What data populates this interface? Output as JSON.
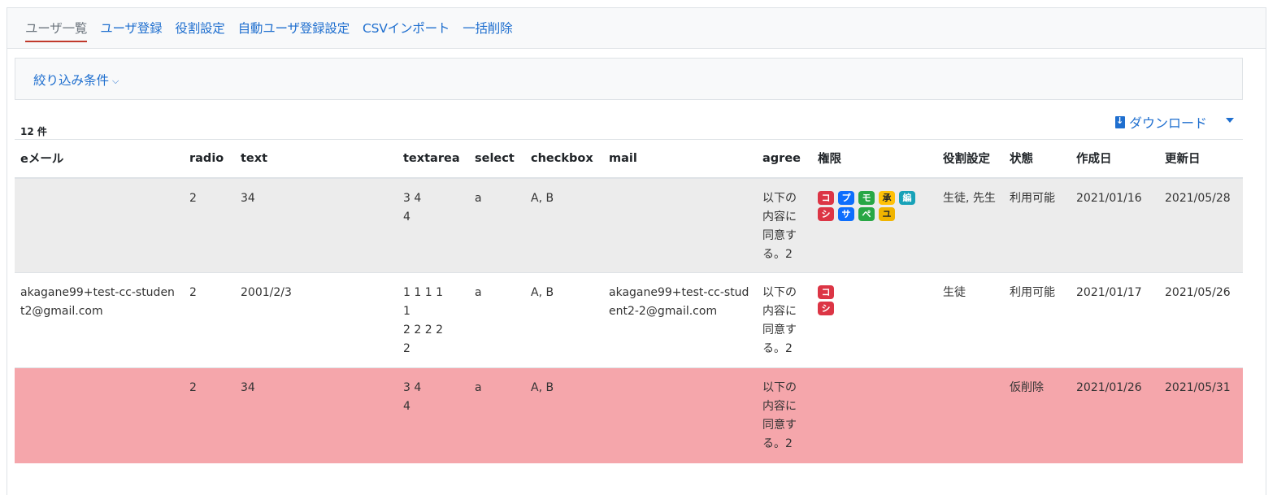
{
  "tabs": [
    {
      "label": "ユーザ一覧",
      "active": true
    },
    {
      "label": "ユーザ登録"
    },
    {
      "label": "役割設定"
    },
    {
      "label": "自動ユーザ登録設定"
    },
    {
      "label": "CSVインポート"
    },
    {
      "label": "一括削除"
    }
  ],
  "filter": {
    "label": "絞り込み条件"
  },
  "count_label": "12 件",
  "download": {
    "label": "ダウンロード"
  },
  "table": {
    "headers": [
      "eメール",
      "radio",
      "text",
      "textarea",
      "select",
      "checkbox",
      "mail",
      "agree",
      "権限",
      "役割設定",
      "状態",
      "作成日",
      "更新日"
    ],
    "rows": [
      {
        "email": "",
        "radio": "2",
        "text": "34",
        "textarea_lines": [
          "3 4",
          "4"
        ],
        "select": "a",
        "checkbox": "A, B",
        "mail": "",
        "agree": "以下の内容に同意する。2",
        "perm_badges": [
          "コ",
          "プ",
          "モ",
          "承",
          "編",
          "シ",
          "サ",
          "ペ",
          "ユ"
        ],
        "roles": "生徒, 先生",
        "status": "利用可能",
        "created": "2021/01/16",
        "updated": "2021/05/28"
      },
      {
        "email": "akagane99+test-cc-student2@gmail.com",
        "radio": "2",
        "text": "2001/2/3",
        "textarea_lines": [
          "1 1 1 1",
          "1",
          "2 2 2 2",
          "2"
        ],
        "select": "a",
        "checkbox": "A, B",
        "mail": "akagane99+test-cc-student2-2@gmail.com",
        "agree": "以下の内容に同意する。2",
        "perm_badges": [
          "コ",
          "シ"
        ],
        "roles": "生徒",
        "status": "利用可能",
        "created": "2021/01/17",
        "updated": "2021/05/26"
      },
      {
        "email": "",
        "radio": "2",
        "text": "34",
        "textarea_lines": [
          "3 4",
          "4"
        ],
        "select": "a",
        "checkbox": "A, B",
        "mail": "",
        "agree": "以下の内容に同意する。2",
        "perm_badges": [],
        "roles": "",
        "status": "仮削除",
        "created": "2021/01/26",
        "updated": "2021/05/31"
      }
    ]
  }
}
